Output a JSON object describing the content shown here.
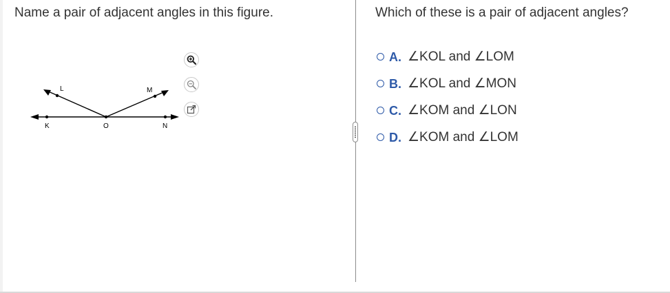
{
  "question": {
    "text": "Name a pair of adjacent angles in this figure."
  },
  "figure": {
    "labels": {
      "K": "K",
      "O": "O",
      "N": "N",
      "L": "L",
      "M": "M"
    },
    "tools": {
      "zoom_in_icon": "zoom-in-icon",
      "zoom_out_icon": "zoom-out-icon",
      "popout_icon": "popout-icon"
    }
  },
  "answer_panel": {
    "prompt": "Which of these is a pair of adjacent angles?",
    "options": [
      {
        "letter": "A.",
        "text": "∠KOL and ∠LOM"
      },
      {
        "letter": "B.",
        "text": "∠KOL and ∠MON"
      },
      {
        "letter": "C.",
        "text": "∠KOM and ∠LON"
      },
      {
        "letter": "D.",
        "text": "∠KOM and ∠LOM"
      }
    ]
  },
  "colors": {
    "accent": "#2e5aa8",
    "text": "#333333",
    "divider": "#8c8c8c"
  }
}
